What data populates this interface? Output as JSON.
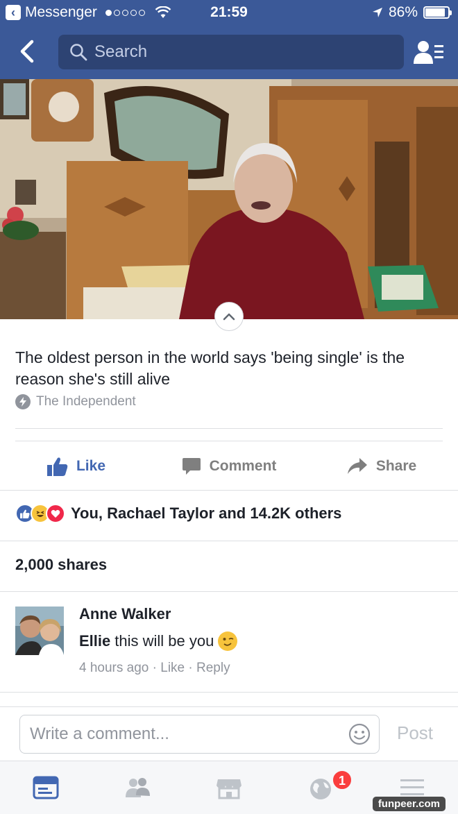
{
  "status_bar": {
    "back_app": "Messenger",
    "time": "21:59",
    "battery": "86%",
    "battery_level": 0.86
  },
  "nav": {
    "search_placeholder": "Search"
  },
  "post": {
    "headline": "The oldest person in the world says 'being single' is the reason she's still alive",
    "source": "The Independent"
  },
  "actions": {
    "like": "Like",
    "comment": "Comment",
    "share": "Share"
  },
  "reactions": {
    "text": "You, Rachael Taylor and 14.2K others"
  },
  "shares": "2,000 shares",
  "comment": {
    "author": "Anne Walker",
    "mention": "Ellie",
    "text": "this will be you",
    "time": "4 hours ago",
    "like": "Like",
    "reply": "Reply"
  },
  "composer": {
    "placeholder": "Write a comment...",
    "post": "Post"
  },
  "tabbar": {
    "notification_count": "1"
  },
  "watermark": "funpeer.com",
  "colors": {
    "brand": "#3b5998",
    "like_blue": "#4267b2",
    "badge_red": "#fa3e3e"
  }
}
